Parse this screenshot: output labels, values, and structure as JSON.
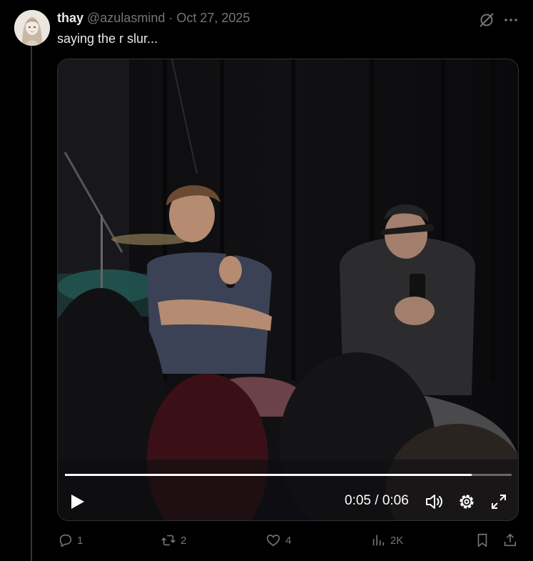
{
  "tweet": {
    "author_name": "thay",
    "author_handle": "@azulasmind",
    "separator": "·",
    "date": "Oct 27, 2025",
    "text": "saying the r slur..."
  },
  "video": {
    "time_display": "0:05 / 0:06",
    "progress_fraction": 0.91
  },
  "actions": {
    "replies": "1",
    "reposts": "2",
    "likes": "4",
    "views": "2K"
  },
  "icons": [
    "grok-icon",
    "more-icon",
    "play-icon",
    "volume-icon",
    "settings-icon",
    "fullscreen-icon",
    "reply-icon",
    "repost-icon",
    "like-icon",
    "views-icon",
    "bookmark-icon",
    "share-icon"
  ],
  "colors": {
    "background": "#000000",
    "text_primary": "#e7e9ea",
    "text_secondary": "#71767b"
  }
}
